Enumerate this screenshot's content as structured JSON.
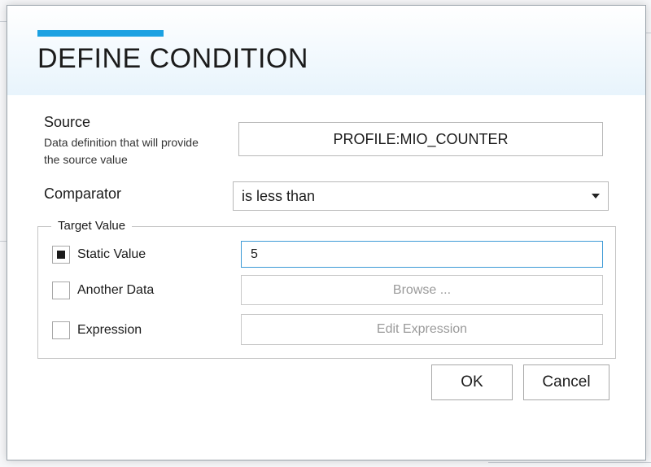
{
  "dialog": {
    "title": "DEFINE CONDITION",
    "source": {
      "label": "Source",
      "description": "Data definition that will provide the source value",
      "value": "PROFILE:MIO_COUNTER"
    },
    "comparator": {
      "label": "Comparator",
      "selected": "is less than"
    },
    "target": {
      "legend": "Target Value",
      "options": [
        {
          "label": "Static Value",
          "checked": true
        },
        {
          "label": "Another Data",
          "checked": false
        },
        {
          "label": "Expression",
          "checked": false
        }
      ],
      "static_value": "5",
      "browse_label": "Browse ...",
      "edit_expression_label": "Edit Expression"
    },
    "ok_label": "OK",
    "cancel_label": "Cancel"
  },
  "colors": {
    "accent": "#1ba1e2",
    "focus_border": "#3d9ad6",
    "disabled_text": "#9a9a9a"
  }
}
